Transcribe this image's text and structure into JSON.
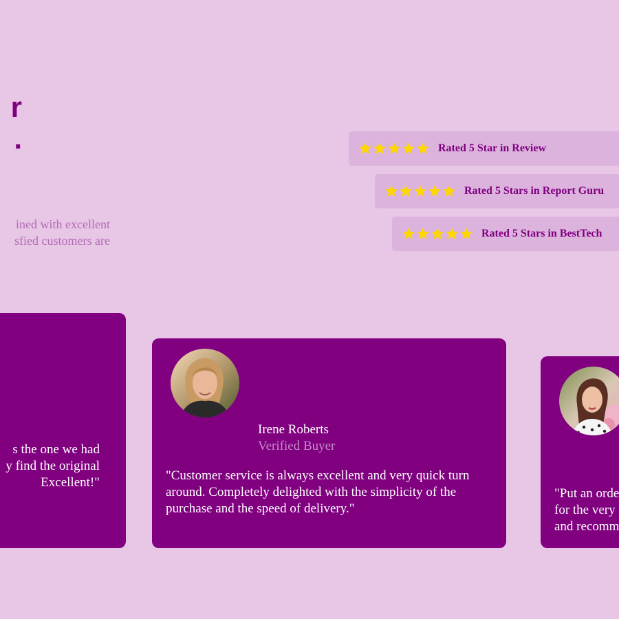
{
  "hero": {
    "title_lines": [
      "r",
      "."
    ],
    "description_lines": [
      "ined with excellent",
      "sfied customers are"
    ]
  },
  "ratings": [
    {
      "label": "Rated 5 Star in Review",
      "stars": 5
    },
    {
      "label": "Rated 5 Stars in Report Guru",
      "stars": 5
    },
    {
      "label": "Rated 5 Stars in BestTech",
      "stars": 5
    }
  ],
  "testimonials": [
    {
      "quote_lines": [
        "s the one we had",
        "y find the original",
        "Excellent!\""
      ]
    },
    {
      "name": "Irene Roberts",
      "role": "Verified Buyer",
      "quote_lines": [
        "\"Customer service is always excellent and very quick turn",
        "around. Completely delighted with the simplicity of the",
        "purchase and the speed of delivery.\""
      ]
    },
    {
      "quote_lines": [
        "\"Put an orde",
        "for the very",
        "and recomm"
      ]
    }
  ],
  "colors": {
    "background": "#E8C6E6",
    "card": "#800080",
    "rating_box": "#DBB3DD",
    "star": "#FFD700",
    "accent_text": "#800080",
    "muted_text": "#B26CB5",
    "role_text": "#C58ACB"
  },
  "icons": {
    "star": "star-icon",
    "avatar": "customer-photo"
  }
}
